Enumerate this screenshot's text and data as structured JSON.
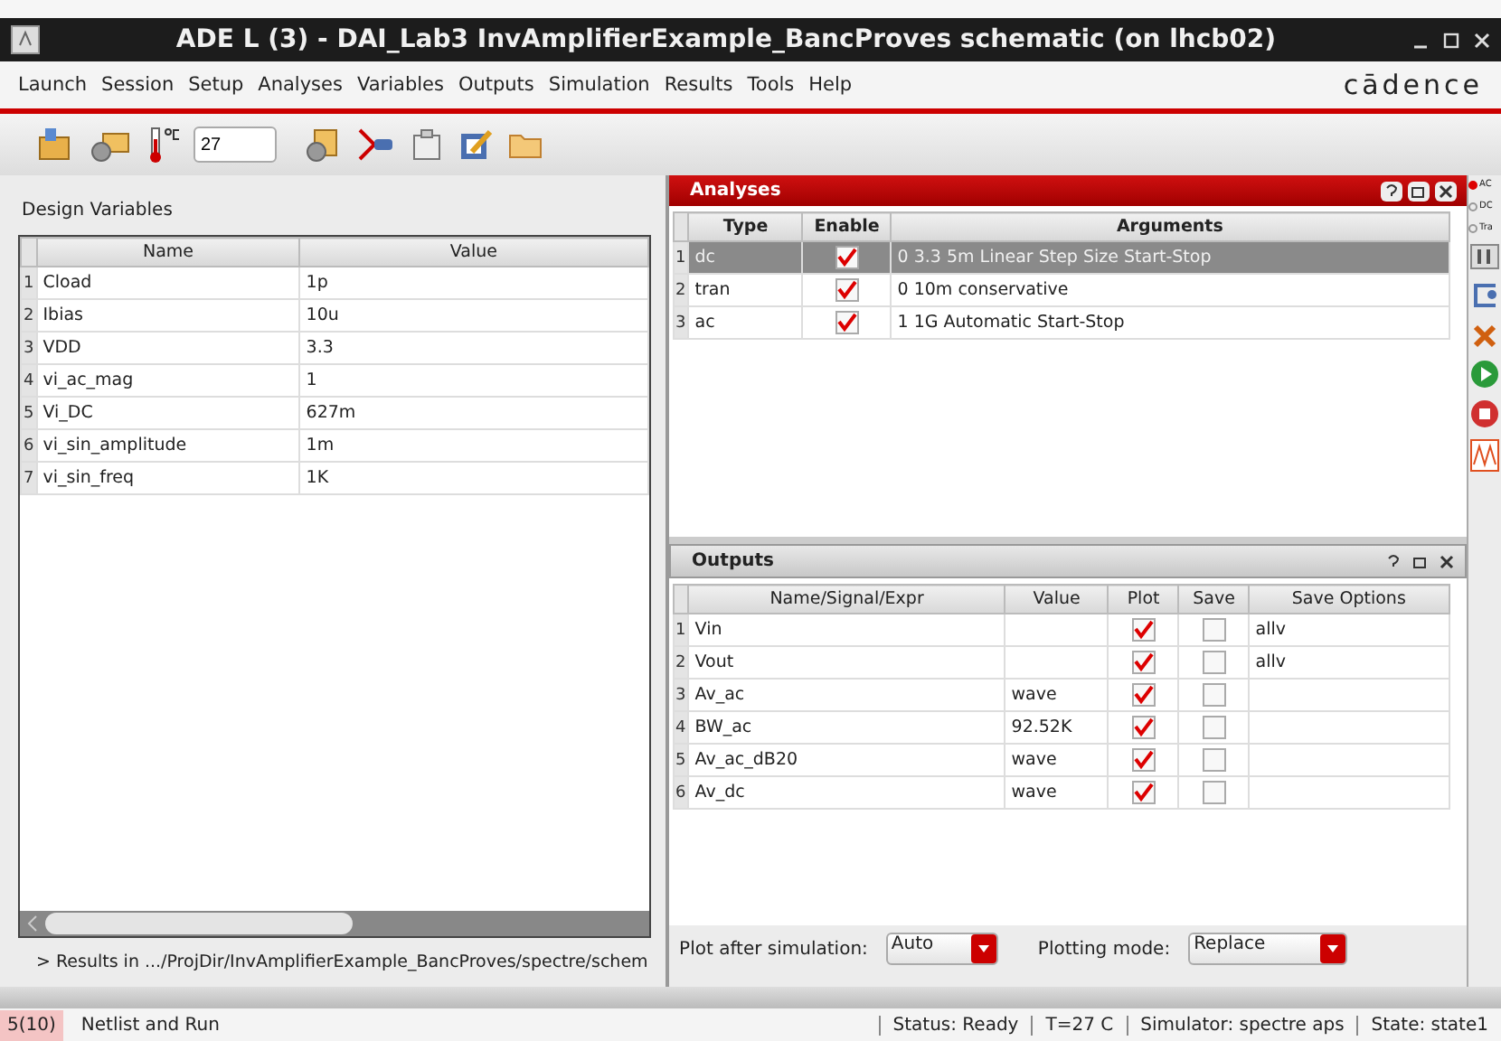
{
  "window": {
    "title": "ADE L (3) - DAI_Lab3 InvAmplifierExample_BancProves schematic (on lhcb02)"
  },
  "menu": [
    "Launch",
    "Session",
    "Setup",
    "Analyses",
    "Variables",
    "Outputs",
    "Simulation",
    "Results",
    "Tools",
    "Help"
  ],
  "brand": "cādence",
  "toolbar": {
    "temperature": "27"
  },
  "design_variables": {
    "title": "Design Variables",
    "columns": [
      "Name",
      "Value"
    ],
    "rows": [
      {
        "index": "1",
        "name": "Cload",
        "value": "1p"
      },
      {
        "index": "2",
        "name": "Ibias",
        "value": "10u"
      },
      {
        "index": "3",
        "name": "VDD",
        "value": "3.3"
      },
      {
        "index": "4",
        "name": "vi_ac_mag",
        "value": "1"
      },
      {
        "index": "5",
        "name": "Vi_DC",
        "value": "627m"
      },
      {
        "index": "6",
        "name": "vi_sin_amplitude",
        "value": "1m"
      },
      {
        "index": "7",
        "name": "vi_sin_freq",
        "value": "1K"
      }
    ]
  },
  "results_path": "> Results in .../ProjDir/InvAmplifierExample_BancProves/spectre/schem",
  "analyses": {
    "title": "Analyses",
    "columns": [
      "Type",
      "Enable",
      "Arguments"
    ],
    "rows": [
      {
        "index": "1",
        "type": "dc",
        "enabled": true,
        "arguments": "0 3.3 5m Linear Step Size Start-Stop",
        "selected": true
      },
      {
        "index": "2",
        "type": "tran",
        "enabled": true,
        "arguments": "0 10m conservative",
        "selected": false
      },
      {
        "index": "3",
        "type": "ac",
        "enabled": true,
        "arguments": "1 1G Automatic Start-Stop",
        "selected": false
      }
    ]
  },
  "side_radios": [
    {
      "label": "AC",
      "selected": true
    },
    {
      "label": "DC",
      "selected": false
    },
    {
      "label": "Tra",
      "selected": false
    }
  ],
  "outputs": {
    "title": "Outputs",
    "columns": [
      "Name/Signal/Expr",
      "Value",
      "Plot",
      "Save",
      "Save Options"
    ],
    "rows": [
      {
        "index": "1",
        "name": "Vin",
        "plot": true,
        "save": false,
        "save_options": "allv"
      },
      {
        "index": "2",
        "name": "Vout",
        "plot": true,
        "save": false,
        "save_options": "allv"
      },
      {
        "index": "3",
        "name": "Av_ac",
        "value": "wave",
        "plot": true,
        "save": false
      },
      {
        "index": "4",
        "name": "BW_ac",
        "value": "92.52K",
        "plot": true,
        "save": false
      },
      {
        "index": "5",
        "name": "Av_ac_dB20",
        "value": "wave",
        "plot": true,
        "save": false
      },
      {
        "index": "6",
        "name": "Av_dc",
        "value": "wave",
        "plot": true,
        "save": false
      }
    ]
  },
  "plot_after_simulation": {
    "label": "Plot after simulation:",
    "value": "Auto"
  },
  "plotting_mode": {
    "label": "Plotting mode:",
    "value": "Replace"
  },
  "status_bar": {
    "count": "5(10)",
    "message": "Netlist and Run",
    "fields": [
      "Status: Ready",
      "T=27 C",
      "Simulator: spectre aps",
      "State: state1"
    ]
  }
}
